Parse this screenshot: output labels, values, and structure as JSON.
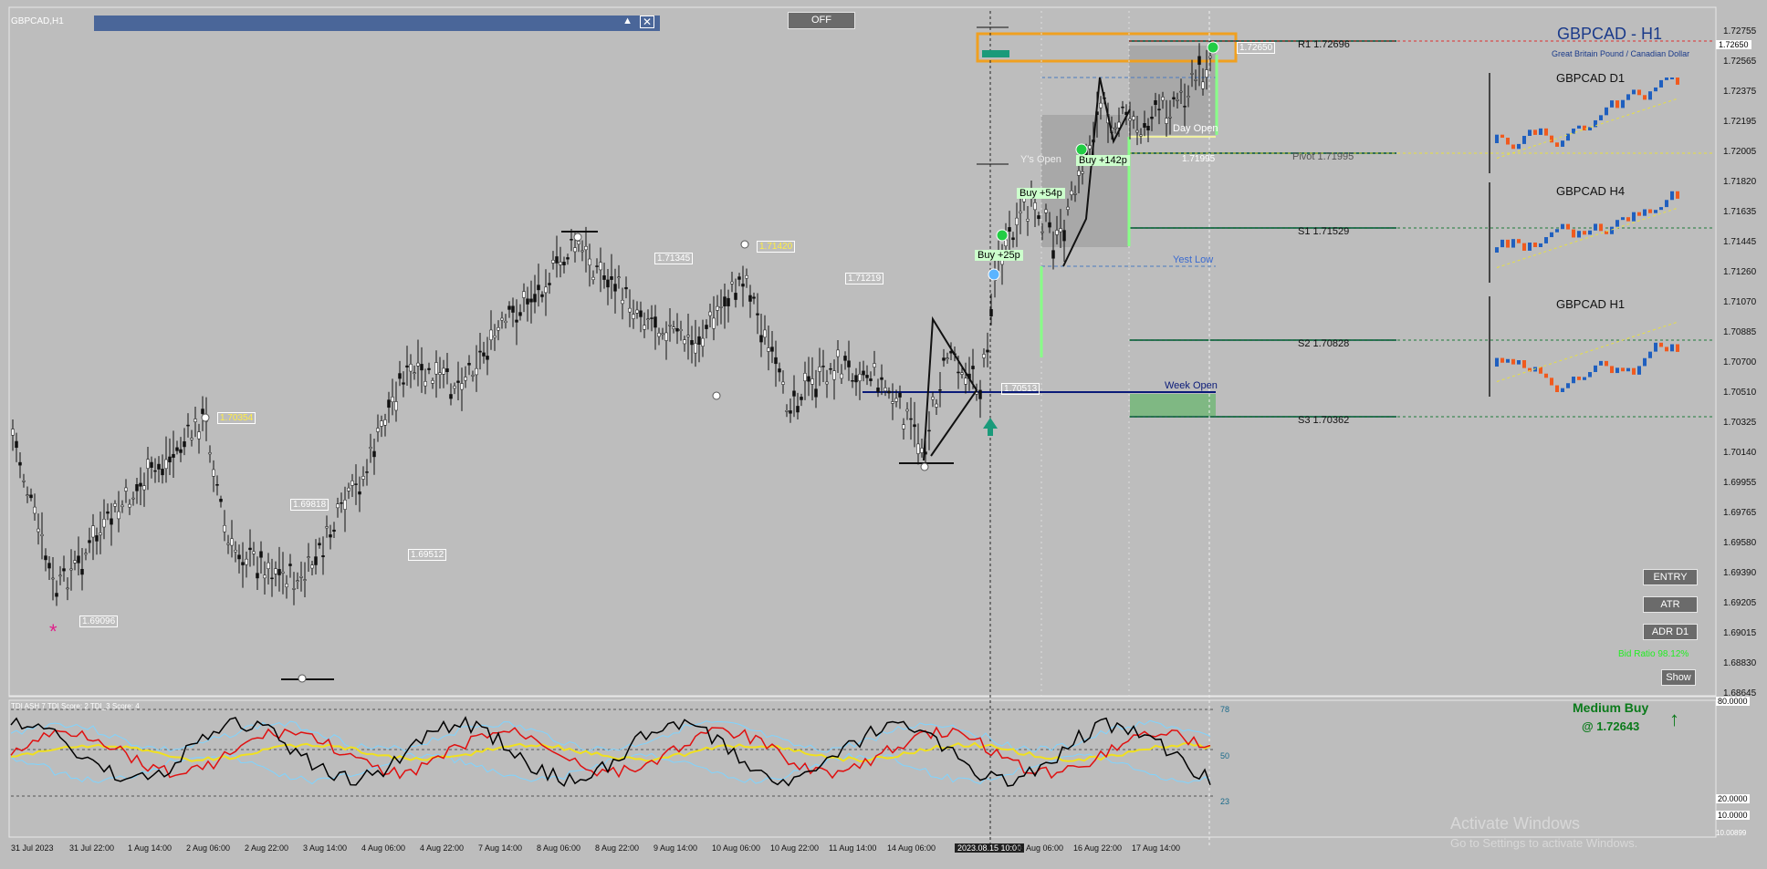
{
  "window": {
    "title": "GBPCAD,H1"
  },
  "toggle": {
    "label": "OFF"
  },
  "header": {
    "symbol_timeframe": "GBPCAD - H1",
    "description": "Great Britain Pound / Canadian Dollar"
  },
  "price_axis": {
    "ticks": [
      "1.72755",
      "1.72565",
      "1.72375",
      "1.72195",
      "1.72005",
      "1.71820",
      "1.71635",
      "1.71445",
      "1.71260",
      "1.71070",
      "1.70885",
      "1.70700",
      "1.70510",
      "1.70325",
      "1.70140",
      "1.69955",
      "1.69765",
      "1.69580",
      "1.69390",
      "1.69205",
      "1.69015",
      "1.68830",
      "1.68645"
    ],
    "current_price": "1.72650"
  },
  "time_axis": {
    "labels": [
      "31 Jul 2023",
      "31 Jul 22:00",
      "1 Aug 14:00",
      "2 Aug 06:00",
      "2 Aug 22:00",
      "3 Aug 14:00",
      "4 Aug 06:00",
      "4 Aug 22:00",
      "7 Aug 14:00",
      "8 Aug 06:00",
      "8 Aug 22:00",
      "9 Aug 14:00",
      "10 Aug 06:00",
      "10 Aug 22:00",
      "11 Aug 14:00",
      "14 Aug 06:00",
      "2023.08.15 10:00",
      "16 Aug 06:00",
      "16 Aug 22:00",
      "17 Aug 14:00"
    ]
  },
  "pivots": [
    {
      "name": "R1",
      "price": "1.72696",
      "text": "R1 1.72696"
    },
    {
      "name": "Pivot",
      "price": "1.71995",
      "text": "Pivot 1.71995"
    },
    {
      "name": "S1",
      "price": "1.71529",
      "text": "S1 1.71529"
    },
    {
      "name": "S2",
      "price": "1.70828",
      "text": "S2 1.70828"
    },
    {
      "name": "S3",
      "price": "1.70362",
      "text": "S3 1.70362"
    }
  ],
  "price_labels": [
    "1.70354",
    "1.69096",
    "1.69818",
    "1.69512",
    "1.71345",
    "1.71420",
    "1.71219",
    "1.70513",
    "1.71995",
    "1.72650"
  ],
  "zone_labels": {
    "week_open": "Week Open",
    "yest_low": "Yest Low",
    "day_open": "Day Open",
    "ys_open": "Y's Open"
  },
  "trade_labels": [
    "Buy +25p",
    "Buy +54p",
    "Buy +142p"
  ],
  "mini_charts": [
    {
      "title": "GBPCAD D1"
    },
    {
      "title": "GBPCAD H4"
    },
    {
      "title": "GBPCAD H1"
    }
  ],
  "side_buttons": [
    "ENTRY",
    "ATR",
    "ADR D1"
  ],
  "show_button": "Show",
  "bid_ratio": "Bid Ratio 98.12%",
  "signal": {
    "title": "Medium Buy",
    "price": "@ 1.72643"
  },
  "indicator": {
    "label": "TDI ASH 7 TDI Score: 2 TDI_3 Score: 4",
    "levels": [
      "78",
      "50",
      "23"
    ],
    "axis_ticks": [
      "80.0000",
      "20.0000",
      "10.0000"
    ],
    "bottom_tick": "10.00899"
  },
  "watermark": {
    "line1": "Activate Windows",
    "line2": "Go to Settings to activate Windows."
  },
  "colors": {
    "background": "#bdbdbd",
    "bull": "#1f5fbf",
    "bear": "#f05a1e",
    "pivot_line": "#1e6e4a",
    "accent": "#f0a020"
  }
}
